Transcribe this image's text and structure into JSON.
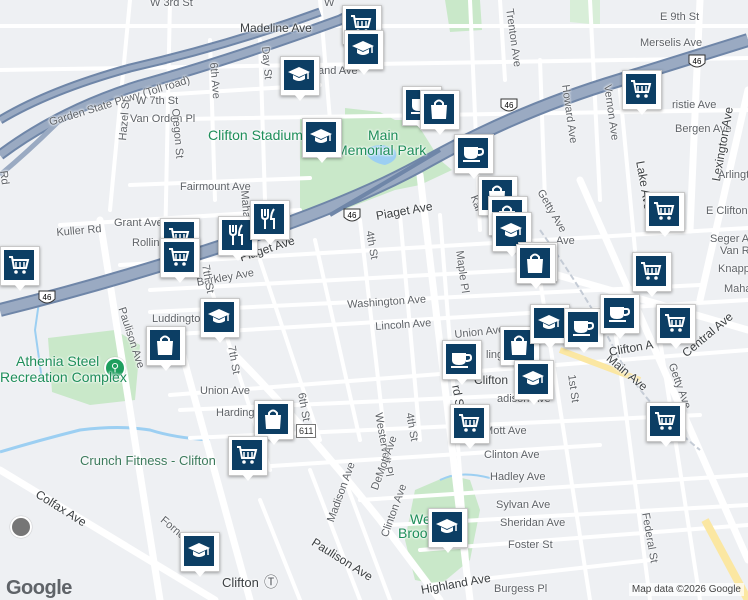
{
  "colors": {
    "background": "#eef0f3",
    "road": "#ffffff",
    "highway": "#8a9cb4",
    "park": "#c9e8c9",
    "water": "#9ccff2",
    "marker": "#0c3e64",
    "rail": "#c5ccd6"
  },
  "highways": {
    "gsp": "Garden State Pkwy (Toll road)",
    "route46": "46",
    "route611": "611"
  },
  "streets": {
    "w3rd": "W 3rd St",
    "madeline": "Madeline Ave",
    "w7th": "W 7th St",
    "vanorden": "Van Orden Pl",
    "hazel": "Hazel St",
    "oregon": "Oregon St",
    "sixth_top": "6th Ave",
    "day": "Day St",
    "and_ave": "and Ave",
    "fairmount": "Fairmount Ave",
    "mahan": "Mahan",
    "grant": "Grant Ave",
    "kuller": "Kuller Rd",
    "rollin": "Rollin",
    "piaget": "Piaget Ave",
    "piaget2": "Piaget Ave",
    "barkley": "Barkley Ave",
    "seventh_st": "7th St",
    "fourth_st": "4th St",
    "washington": "Washington Ave",
    "lincoln": "Lincoln Ave",
    "luddington": "Luddingto",
    "seventh_st2": "7th St",
    "paulison": "Paulison Ave",
    "union": "Union Ave",
    "union2": "Union Ave",
    "harding": "Harding",
    "sixth_st": "6th St",
    "westervelt": "Westervelt Pl",
    "fourth_st2": "4th St",
    "maple": "Maple Pl",
    "demott": "DeMott Ave",
    "demott2": "DeMott Ave",
    "clinton": "Clinton Ave",
    "clinton2": "Clinton Ave",
    "hadley": "Hadley Ave",
    "sylvan": "Sylvan Ave",
    "sheridan": "Sheridan Ave",
    "foster": "Foster St",
    "highland": "Highland Ave",
    "burgess": "Burgess Pl",
    "madison": "Madison Ave",
    "madison2": "adison Ave",
    "colfax": "Colfax Ave",
    "paulison2": "Paulison Ave",
    "fornelius": "Fornelius A",
    "trenton": "Trenton Ave",
    "e9th": "E 9th St",
    "merselis": "Merselis Ave",
    "howard": "Howard Ave",
    "vernon": "Vernon Ave",
    "bergen": "Bergen Ave",
    "christie": "ristie Ave",
    "getty": "Getty Ave",
    "getty2": "Getty Ave",
    "lexington": "Lexington Ave",
    "lake": "Lake Ave",
    "arling": "Arlingt",
    "eclifton": "E Clifton",
    "seger": "Seger Av",
    "vanr": "Van R",
    "knapp": "Knapp",
    "maha": "Maha",
    "first_st": "1st St",
    "main": "Main Ave",
    "clifton_ave": "Clifton A",
    "central": "Central Ave",
    "federal": "Federal St",
    "third": "rd St",
    "ling": "ling",
    "kar": "Kar",
    "ave_r": "Ave",
    "rd": "Rd",
    "clifton_c": "Clifton",
    "w_partial": "W"
  },
  "places": {
    "stadium": "Clifton Stadium",
    "park_line1": "Main",
    "park_line2": "Memorial Park",
    "athenia_line1": "Athenia Steel",
    "athenia_line2": "Recreation Complex",
    "crunch": "Crunch Fitness - Clifton",
    "clifton_station": "Clifton",
    "wb_line1": "We",
    "wb_line2": "Brook"
  },
  "attribution": "Map data ©2026 Google",
  "logo": "Google",
  "markers": [
    {
      "icon": "cart"
    },
    {
      "icon": "school"
    },
    {
      "icon": "school"
    },
    {
      "icon": "coffee"
    },
    {
      "icon": "bag"
    },
    {
      "icon": "school"
    },
    {
      "icon": "coffee"
    },
    {
      "icon": "bag"
    },
    {
      "icon": "bag"
    },
    {
      "icon": "school"
    },
    {
      "icon": "bag"
    },
    {
      "icon": "cart"
    },
    {
      "icon": "cart"
    },
    {
      "icon": "cart"
    },
    {
      "icon": "cart"
    },
    {
      "icon": "restaurant"
    },
    {
      "icon": "restaurant"
    },
    {
      "icon": "cart"
    },
    {
      "icon": "cart"
    },
    {
      "icon": "school"
    },
    {
      "icon": "bag"
    },
    {
      "icon": "bag"
    },
    {
      "icon": "school"
    },
    {
      "icon": "coffee"
    },
    {
      "icon": "coffee"
    },
    {
      "icon": "coffee"
    },
    {
      "icon": "bag"
    },
    {
      "icon": "school"
    },
    {
      "icon": "cart"
    },
    {
      "icon": "bag"
    },
    {
      "icon": "cart"
    },
    {
      "icon": "cart"
    },
    {
      "icon": "school"
    },
    {
      "icon": "school"
    },
    {
      "icon": "cart"
    }
  ]
}
